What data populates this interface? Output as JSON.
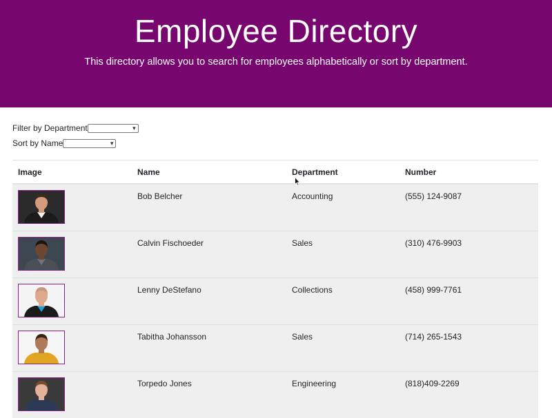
{
  "header": {
    "title": "Employee Directory",
    "subtitle": "This directory allows you to search for employees alphabetically or sort by department."
  },
  "filters": {
    "department_label": "Filter by Department",
    "department_value": "",
    "name_label": "Sort by Name",
    "name_value": ""
  },
  "table": {
    "columns": [
      "Image",
      "Name",
      "Department",
      "Number"
    ],
    "rows": [
      {
        "name": "Bob Belcher",
        "department": "Accounting",
        "number": "(555) 124-9087",
        "photo": {
          "bg": "#2b2b2b",
          "skin": "#d29b7e",
          "hair": "#3a2a1e",
          "shirt": "#f0f0f0",
          "jacket": "#1c1c1c"
        }
      },
      {
        "name": "Calvin Fischoeder",
        "department": "Sales",
        "number": "(310) 476-9903",
        "photo": {
          "bg": "#3d4752",
          "skin": "#6b4630",
          "hair": "#1a1512",
          "shirt": "#6e757d",
          "jacket": "#4a4f55"
        }
      },
      {
        "name": "Lenny DeStefano",
        "department": "Collections",
        "number": "(458) 999-7761",
        "photo": {
          "bg": "#f4f4f4",
          "skin": "#dca88e",
          "hair": "#c9977d",
          "shirt": "#1e9fd6",
          "jacket": "#1a1a1a"
        }
      },
      {
        "name": "Tabitha Johansson",
        "department": "Sales",
        "number": "(714) 265-1543",
        "photo": {
          "bg": "#f6f6f6",
          "skin": "#b07a5a",
          "hair": "#3b2314",
          "shirt": "#e2a523",
          "jacket": "#e2a523"
        }
      },
      {
        "name": "Torpedo Jones",
        "department": "Engineering",
        "number": "(818)409-2269",
        "photo": {
          "bg": "#3a3a3a",
          "skin": "#e2b29a",
          "hair": "#7a4a2c",
          "shirt": "#2d3a55",
          "jacket": "#2d3a55"
        }
      }
    ]
  },
  "colors": {
    "banner": "#77066f",
    "row_bg": "#efefef",
    "photo_border": "#8a1d8a"
  }
}
